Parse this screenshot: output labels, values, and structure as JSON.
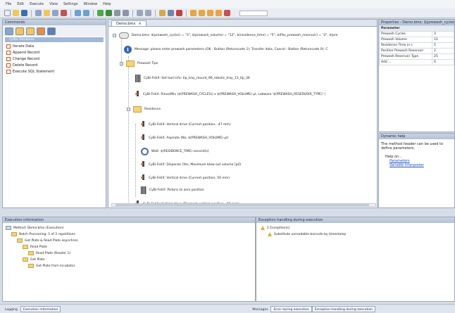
{
  "menu": [
    "File",
    "Edit",
    "Execute",
    "View",
    "Settings",
    "Window",
    "Help"
  ],
  "commands_panel": {
    "title": "Commands",
    "selected": "CyBio Database",
    "items": [
      "Iterate Data",
      "Append Record",
      "Change Record",
      "Delete Record",
      "Execute SQL Statement"
    ]
  },
  "editor": {
    "tab": "Demo.bmx",
    "rows": [
      "Demo.bmx: $(prewash_cycles) = \"3\", $(prewash_volume) = \"12\", $(residence_time) = \"5\", $(Pos_prewash_reservoir) = \"2\", $(pre",
      "Message: please enter prewash parameters (OK - Button (Returncode 1): Transfer data, Cancel - Button (Returncode 0): C",
      "Prewash Tips",
      "CyBi-FeliX: Set tool info: tip_tray_mount_96_robotic_tray_13_tip_36",
      "CyBi-FeliX: Rinse/Mix ($(PREWASH_CYCLES)) x $(PREWASH_VOLUME) µl, Labware '$(PREWASH_RESERVOIR_TYPE)' (",
      "Residence",
      "CyBi-FeliX: Vertical drive (Current position, -47 mm)",
      "CyBi-FeliX: Aspirate (No, $(PREWASH_VOLUME) µl)",
      "Wait: $(RESIDENCE_TIME) second(s)",
      "CyBi-FeliX: Dispense (Yes, Maximum blow out volume [µl])",
      "CyBi-FeliX: Vertical drive (Current position, 50 mm)",
      "CyBi-FeliX: Pistons to zero position",
      "CyBi-FeliX: Vertical drive (Topmost vertical position, -60 mm)"
    ]
  },
  "properties": {
    "title": "Properties - Demo.bmx: $(prewash_cycles)",
    "group": "Parameter",
    "rows": [
      {
        "k": "Prewash Cycles",
        "v": "3"
      },
      {
        "k": "Prewash Volume",
        "v": "12"
      },
      {
        "k": "Residence Time in s",
        "v": "5"
      },
      {
        "k": "Position Prewash Reservoir",
        "v": "2"
      },
      {
        "k": "Prewash Reservoir Type",
        "v": "25"
      },
      {
        "k": "Add ...",
        "v": "0"
      }
    ]
  },
  "dynamic_help": {
    "title": "Dynamic help",
    "text": "The method header can be used to define parameters.",
    "help_on": "Help on...",
    "links": [
      "Parameters",
      "Variable interpreter"
    ]
  },
  "execution": {
    "title": "Execution information",
    "rows": [
      "Method: Demo.bmx (Execution)",
      "Batch Processing: 1 of 2 repetitions",
      "Get Plate & Read Plate asynchron",
      "Read Plate",
      "Read Plate (Reader 1)",
      "Get Plate",
      "Get Plate from Incubator"
    ]
  },
  "exception": {
    "title": "Exception handling during execution",
    "rows": [
      "1 Exception(s)",
      "Substitute unreadable barcode by timestamp"
    ]
  },
  "status_tabs": {
    "left": [
      "Logging",
      "Execution information"
    ],
    "right": [
      "Messages",
      "Error during execution",
      "Exception handling during execution"
    ]
  }
}
